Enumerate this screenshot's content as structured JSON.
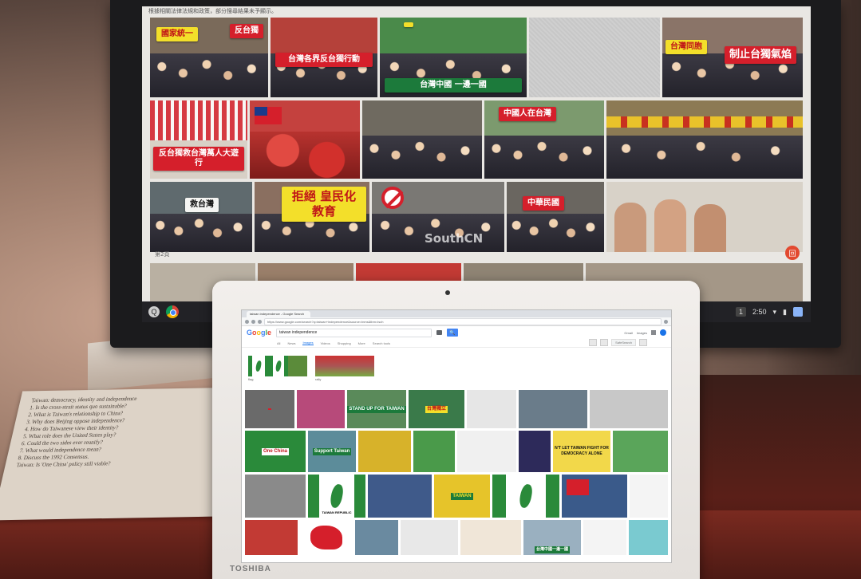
{
  "monitor": {
    "caption": "根據相關法律法規和政策，部分搜尋結果未予顯示。",
    "tiles": [
      [
        "反台獨",
        "台灣各界反台獨行動",
        "",
        "",
        "制止台獨氣焰"
      ],
      [
        "",
        "",
        "台灣中國 一邊一國",
        "中國人在台灣",
        ""
      ],
      [
        "救台灣",
        "拒絕 皇民化教育",
        "SouthCN",
        "",
        ""
      ]
    ],
    "extra_signs": {
      "tile_0_0": "國家統一",
      "tile_0_4_b": "台灣同胞",
      "tile_1_0": "反台獨救台灣萬人大遊行",
      "tile_2_3": "中華民國"
    },
    "watermark": "SouthCN",
    "section_label": "第2頁",
    "floating_button": "回"
  },
  "taskbar": {
    "launcher": "Q",
    "badge": "1",
    "time": "2:50",
    "wifi": "▾",
    "battery": "▮"
  },
  "laptop": {
    "brand": "TOSHIBA",
    "tab_title": "taiwan independence - Google Search",
    "url": "https://www.google.com/search?q=taiwan+independence&source=lnms&tbm=isch",
    "search_query": "taiwan independence",
    "search_button": "🔍",
    "top_links": [
      "Gmail",
      "Images"
    ],
    "tabs": [
      "All",
      "News",
      "Images",
      "Videos",
      "Shopping",
      "More",
      "Search tools"
    ],
    "active_tab": "Images",
    "safe_search": "SafeSearch",
    "related": [
      {
        "caption": "flag"
      },
      {
        "caption": "rally"
      }
    ],
    "rows": [
      [
        "",
        "",
        "STAND UP FOR TAIWAN",
        "台灣獨立",
        "",
        "",
        ""
      ],
      [
        "One China",
        "Support Taiwan",
        "",
        "",
        "",
        "N'T LET TAIWAN FIGHT FOR DEMOCRACY ALONE",
        ""
      ],
      [
        "",
        "TAIWAN REPUBLIC",
        "",
        "TAIWAN",
        "",
        "",
        ""
      ],
      [
        "",
        "",
        "",
        "",
        "",
        "台灣中國一邊一國",
        ""
      ]
    ]
  },
  "paper": {
    "text": "Taiwan: democracy, identity and independence\n1. Is the cross-strait status quo sustainable?\n2. What is Taiwan's relationship to China?\n3. Why does Beijing oppose independence?\n4. How do Taiwanese view their identity?\n5. What role does the United States play?\n6. Could the two sides ever reunify?\n7. What would independence mean?\n8. Discuss the 1992 Consensus.\nTaiwan: Is 'One China' policy still viable?"
  },
  "colors": {
    "red": "#d51f2b",
    "yellow": "#f3df2a",
    "green": "#1c7a3b",
    "google_blue": "#4285f4"
  }
}
